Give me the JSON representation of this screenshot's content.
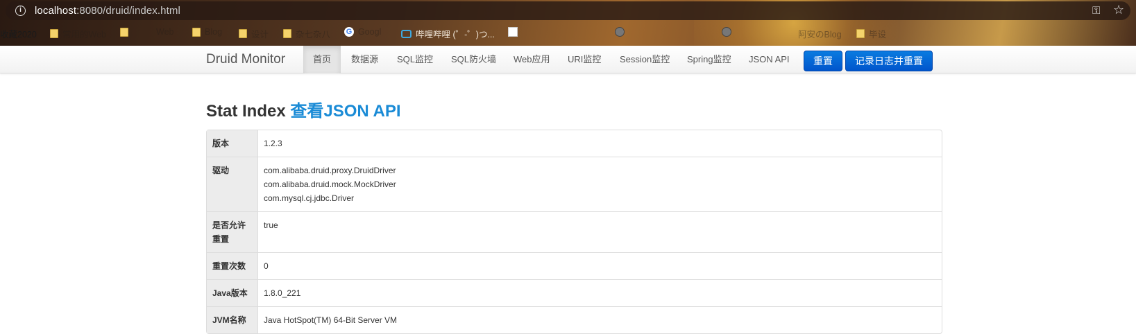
{
  "browser": {
    "url_host": "localhost",
    "url_rest": ":8080/druid/index.html",
    "bookmarks": [
      {
        "label": "收藏2020",
        "icon": "none"
      },
      {
        "label": "常用的Web",
        "icon": "folder-icon"
      },
      {
        "label": "Web",
        "icon": "folder-icon"
      },
      {
        "label": "Blog",
        "icon": "folder-icon"
      },
      {
        "label": "设计",
        "icon": "folder-icon"
      },
      {
        "label": "杂七杂八",
        "icon": "folder-icon"
      },
      {
        "label": "Googl",
        "icon": "google-icon"
      },
      {
        "label": "哔哩哔哩 (゜-゜)つ...",
        "icon": "bilibili-icon"
      },
      {
        "label": "",
        "icon": "page-icon"
      },
      {
        "label": "",
        "icon": "globe-icon"
      },
      {
        "label": "阿安のBlog",
        "icon": "none"
      },
      {
        "label": "毕设",
        "icon": "folder-icon"
      }
    ]
  },
  "navbar": {
    "brand": "Druid Monitor",
    "items": [
      "首页",
      "数据源",
      "SQL监控",
      "SQL防火墙",
      "Web应用",
      "URI监控",
      "Session监控",
      "Spring监控",
      "JSON API"
    ],
    "active_index": 0,
    "reset_button": "重置",
    "log_reset_button": "记录日志并重置"
  },
  "page": {
    "title": "Stat Index",
    "json_link": "查看JSON API"
  },
  "stats": [
    {
      "key": "版本",
      "values": [
        "1.2.3"
      ]
    },
    {
      "key": "驱动",
      "values": [
        "com.alibaba.druid.proxy.DruidDriver",
        "com.alibaba.druid.mock.MockDriver",
        "com.mysql.cj.jdbc.Driver"
      ]
    },
    {
      "key": "是否允许重置",
      "values": [
        "true"
      ]
    },
    {
      "key": "重置次数",
      "values": [
        "0"
      ]
    },
    {
      "key": "Java版本",
      "values": [
        "1.8.0_221"
      ]
    },
    {
      "key": "JVM名称",
      "values": [
        "Java HotSpot(TM) 64-Bit Server VM"
      ]
    }
  ],
  "colors": {
    "primary_button": "#0055cc",
    "json_link": "#1a8bd6",
    "key_cell_bg": "#ececec"
  }
}
